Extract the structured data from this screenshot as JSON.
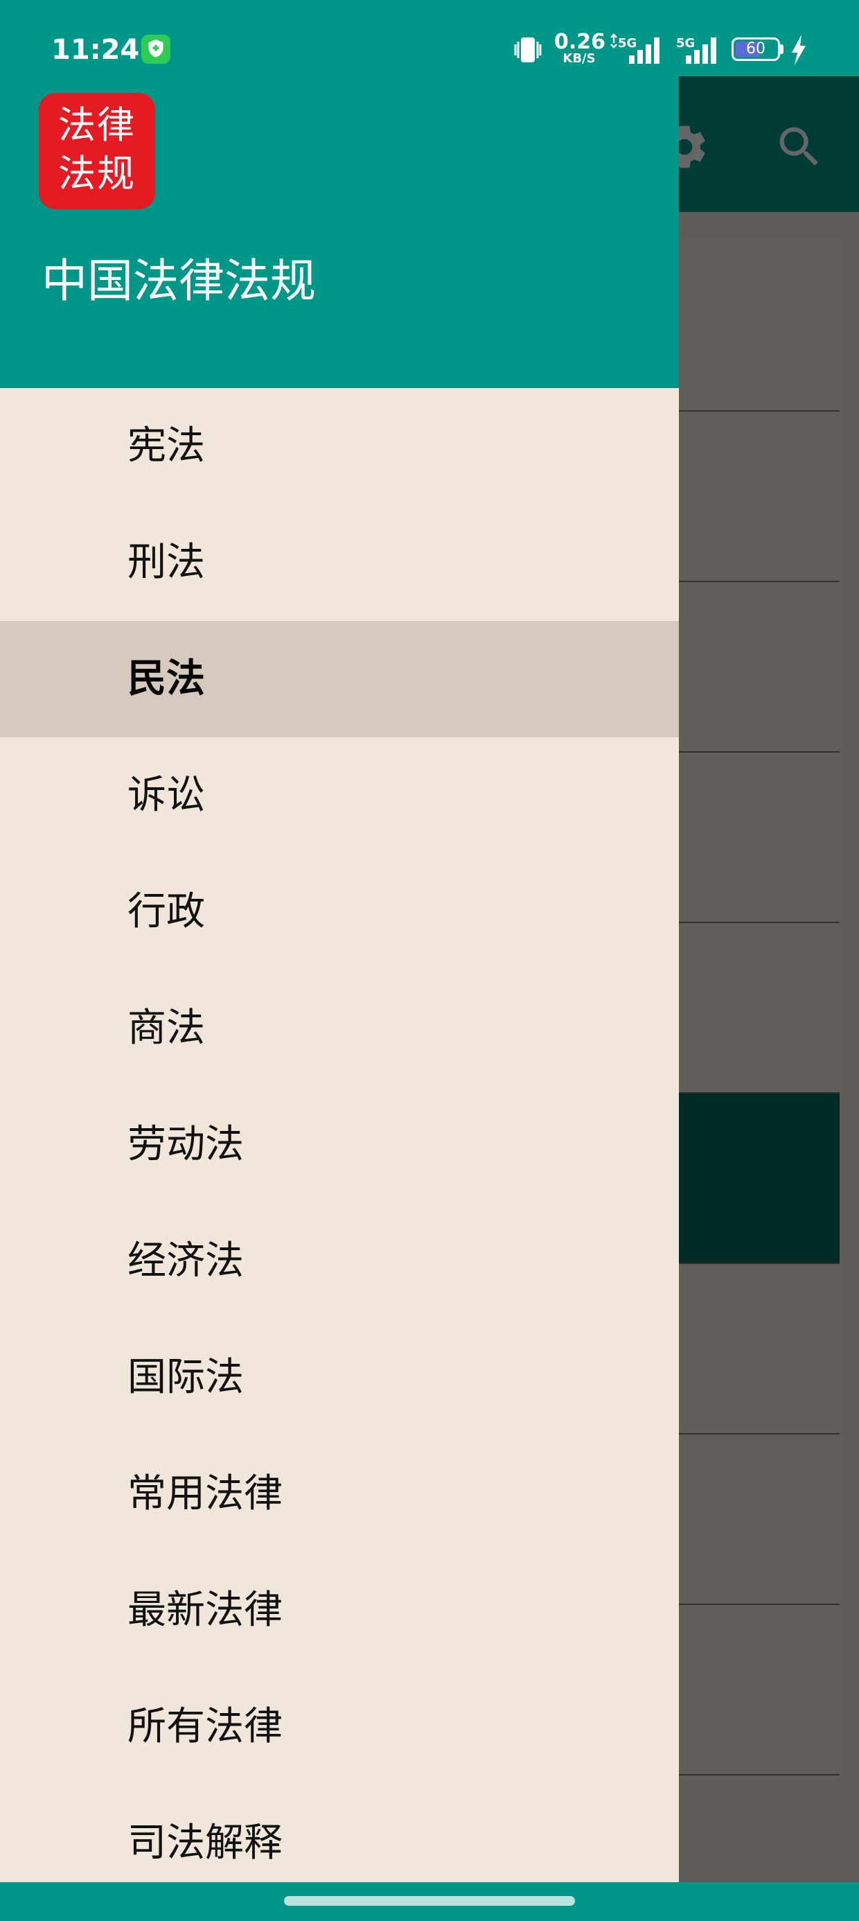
{
  "status_bar": {
    "time": "11:24",
    "net_speed_value": "0.26",
    "net_speed_unit": "KB/S",
    "signal_1_label": "5G",
    "signal_2_label": "5G",
    "battery_level": 60,
    "battery_text": "60",
    "icons": [
      "shield-app-icon",
      "vibrate-icon",
      "data-arrows-icon",
      "signal-icon",
      "battery-icon",
      "charging-icon"
    ]
  },
  "drawer": {
    "logo_line1": "法律",
    "logo_line2": "法规",
    "app_title": "中国法律法规",
    "items": [
      {
        "label": "宪法",
        "selected": false
      },
      {
        "label": "刑法",
        "selected": false
      },
      {
        "label": "民法",
        "selected": true
      },
      {
        "label": "诉讼",
        "selected": false
      },
      {
        "label": "行政",
        "selected": false
      },
      {
        "label": "商法",
        "selected": false
      },
      {
        "label": "劳动法",
        "selected": false
      },
      {
        "label": "经济法",
        "selected": false
      },
      {
        "label": "国际法",
        "selected": false
      },
      {
        "label": "常用法律",
        "selected": false
      },
      {
        "label": "最新法律",
        "selected": false
      },
      {
        "label": "所有法律",
        "selected": false
      },
      {
        "label": "司法解释",
        "selected": false
      }
    ]
  },
  "background_app": {
    "toolbar_icons": [
      "settings-icon",
      "search-icon"
    ]
  },
  "colors": {
    "primary": "#009688",
    "drawer_bg": "#f1e6da",
    "selected_item_bg": "#d5cabd",
    "logo_red": "#e51b23",
    "battery_fill": "#5b6cd6"
  }
}
